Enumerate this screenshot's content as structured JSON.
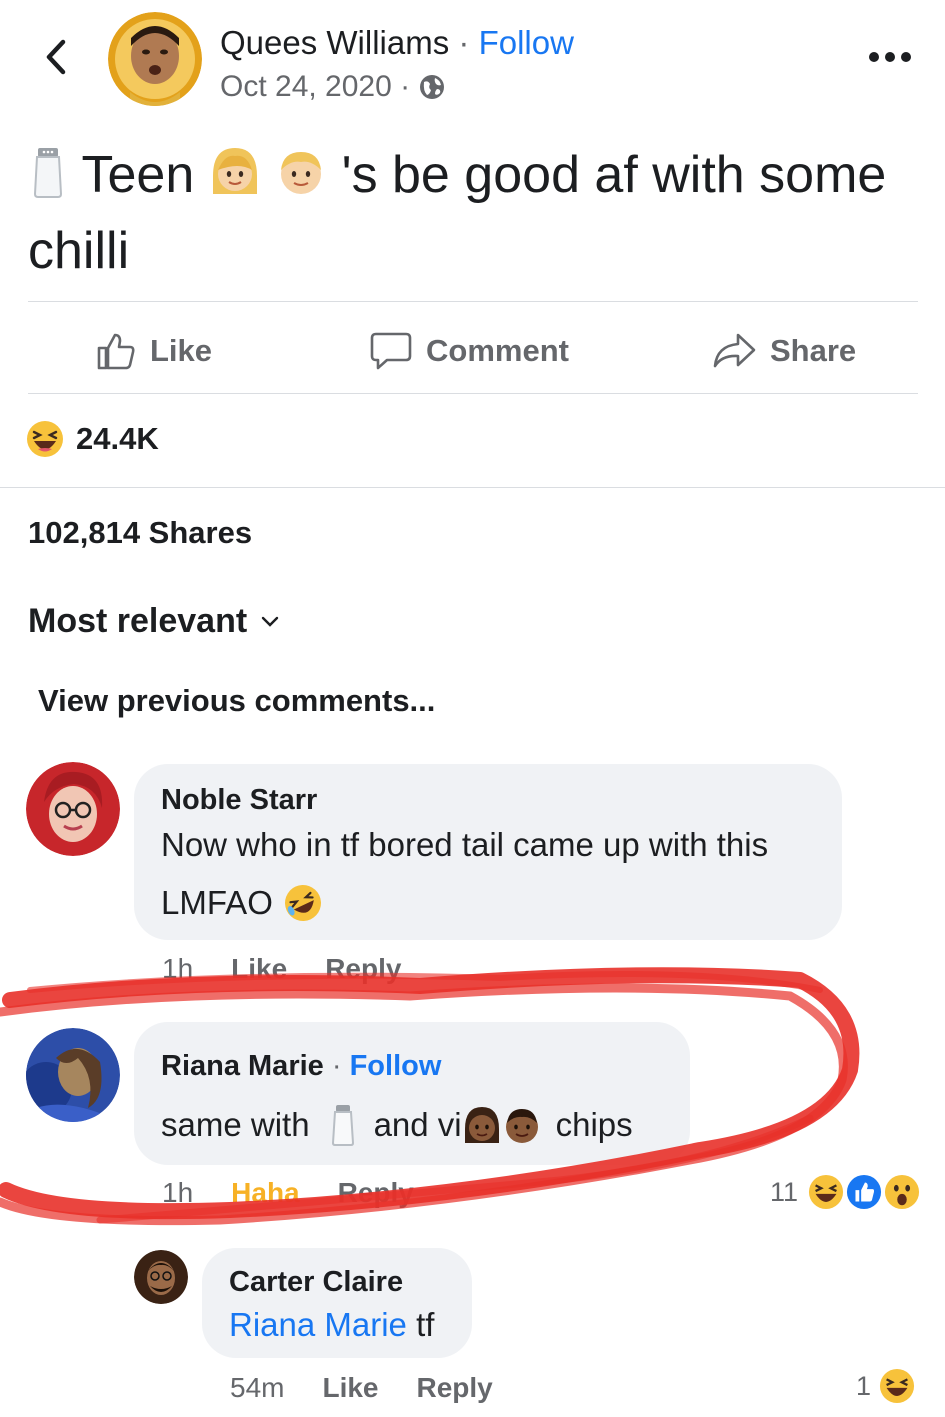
{
  "post": {
    "author": "Quees Williams",
    "separator": "·",
    "follow_label": "Follow",
    "date": "Oct 24, 2020 ·",
    "text_part1": "Teen",
    "text_part2": "'s  be good af with some chilli",
    "colors": {
      "link": "#1877f2",
      "muted": "#65676b",
      "bubble": "#f0f2f5",
      "scribble": "#e8312a"
    }
  },
  "actions": {
    "like": "Like",
    "comment": "Comment",
    "share": "Share"
  },
  "stats": {
    "reaction_count": "24.4K",
    "shares": "102,814 Shares"
  },
  "comments_header": {
    "sort": "Most relevant",
    "view_previous": "View previous comments..."
  },
  "comments": [
    {
      "name": "Noble Starr",
      "text_line1": "Now who in tf bored tail came up with this",
      "text_line2": "LMFAO",
      "time": "1h",
      "like": "Like",
      "reply": "Reply"
    },
    {
      "name": "Riana Marie",
      "separator": "·",
      "follow": "Follow",
      "text_part1": "same with",
      "text_part2": "and vi",
      "text_part3": "chips",
      "time": "1h",
      "reaction": "Haha",
      "reply": "Reply",
      "reaction_count": "11"
    },
    {
      "name": "Carter Claire",
      "mention": "Riana Marie",
      "text": "tf",
      "time": "54m",
      "like": "Like",
      "reply": "Reply",
      "reaction_count": "1"
    }
  ]
}
